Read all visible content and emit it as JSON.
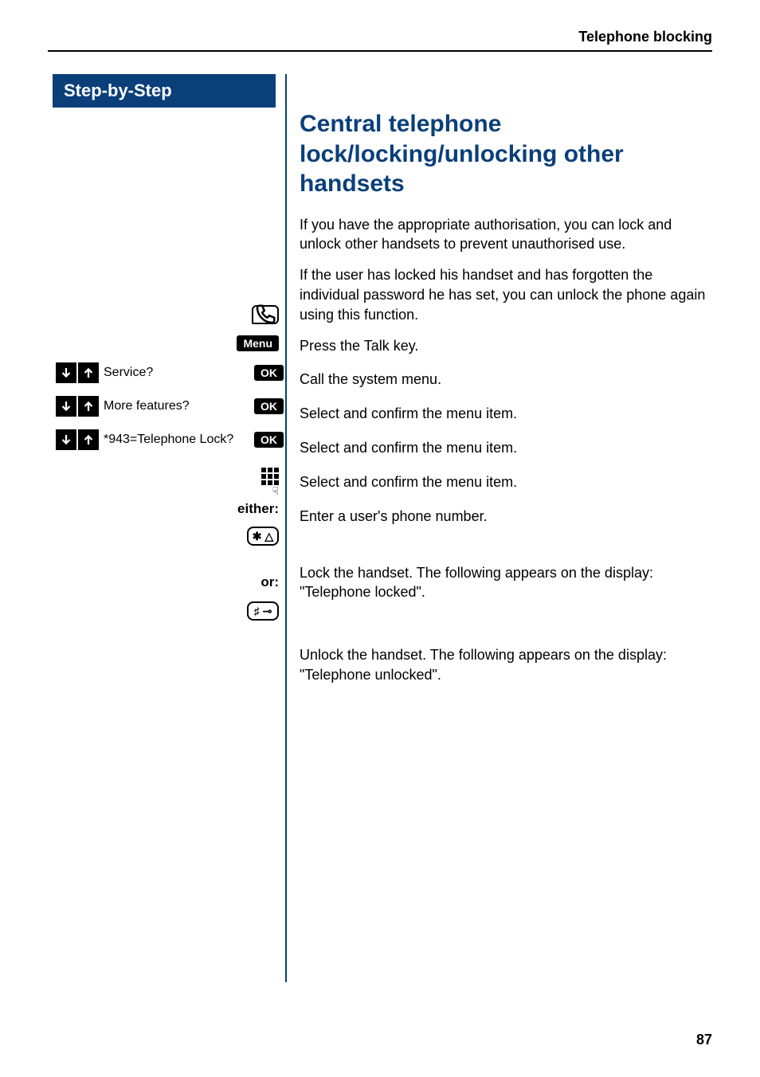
{
  "header": {
    "section": "Telephone blocking"
  },
  "sidebar": {
    "title": "Step-by-Step",
    "menu_label": "Menu",
    "ok_label": "OK",
    "either_label": "either:",
    "or_label": "or:",
    "items": {
      "service": "Service?",
      "more_features": "More features?",
      "tel_lock": "*943=Telephone Lock?"
    },
    "keys": {
      "star": "✱ △",
      "hash": "♯ ⊸"
    }
  },
  "content": {
    "title": "Central telephone lock/locking/unlocking other handsets",
    "p1": "If you have the appropriate authorisation, you can lock and unlock other handsets to prevent unauthorised use.",
    "p2": "If the user has locked his handset and has forgotten the individual password he has set, you can unlock the phone again using this function.",
    "s_talk": "Press the Talk key.",
    "s_menu": "Call the system menu.",
    "s_sel1": "Select and confirm the menu item.",
    "s_sel2": "Select and confirm the menu item.",
    "s_sel3": "Select and confirm the menu item.",
    "s_enter": "Enter a user's phone number.",
    "s_lock": "Lock the handset. The following appears on the display: \"Telephone locked\".",
    "s_unlock": "Unlock the handset. The following appears on the display: \"Telephone unlocked\"."
  },
  "page_number": "87"
}
